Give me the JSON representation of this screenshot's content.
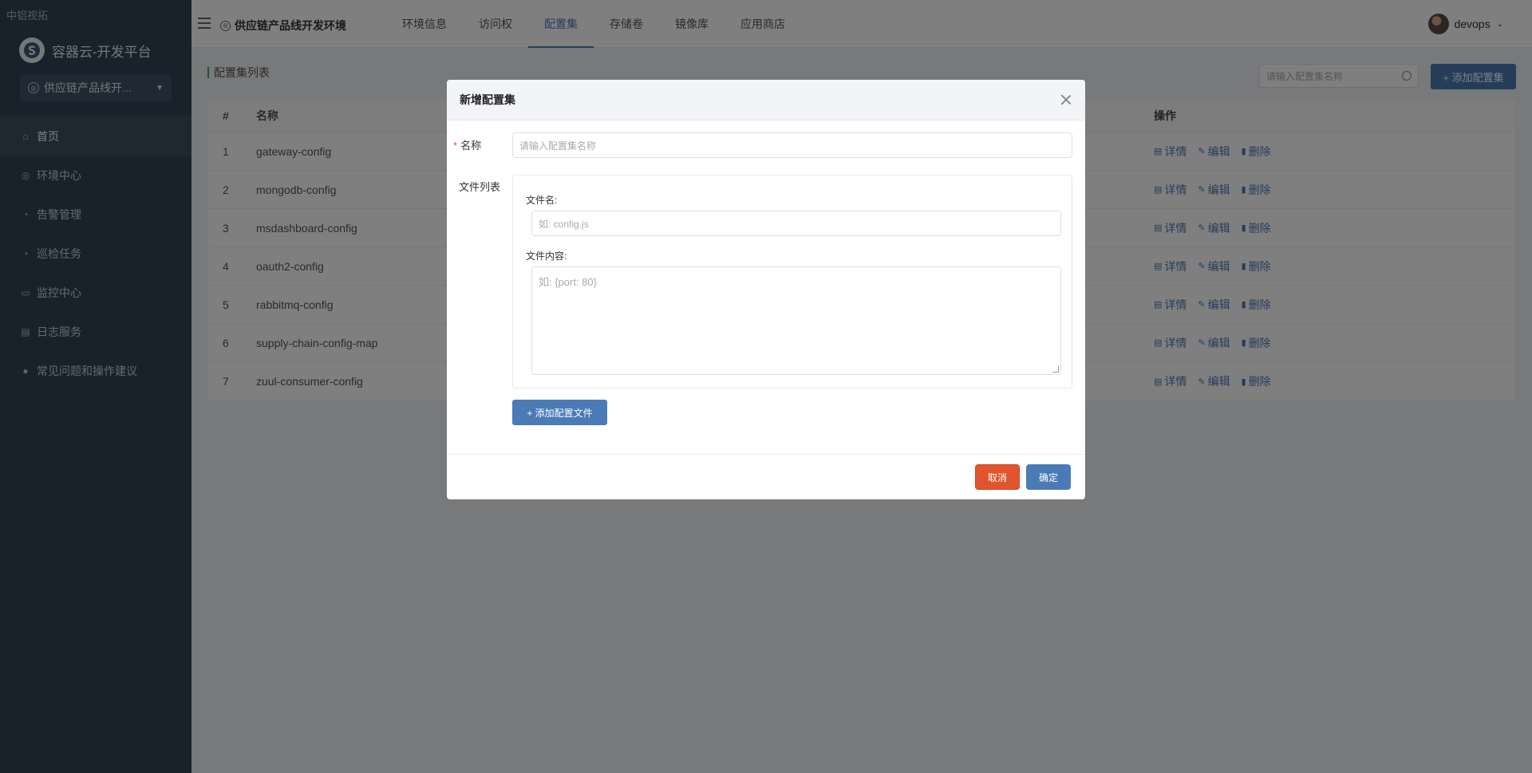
{
  "corner_label": "中铝视拓",
  "brand": {
    "title": "容器云-开发平台"
  },
  "env_select": {
    "value": "供应链产品线开..."
  },
  "nav": [
    {
      "label": "首页",
      "icon": "home-icon"
    },
    {
      "label": "环境中心",
      "icon": "compass-icon"
    },
    {
      "label": "告警管理",
      "icon": "alarm-icon"
    },
    {
      "label": "巡检任务",
      "icon": "inspect-icon"
    },
    {
      "label": "监控中心",
      "icon": "monitor-icon"
    },
    {
      "label": "日志服务",
      "icon": "log-icon"
    },
    {
      "label": "常见问题和操作建议",
      "icon": "help-icon"
    }
  ],
  "header": {
    "env_title": "供应链产品线开发环境",
    "tabs": [
      "环境信息",
      "访问权",
      "配置集",
      "存储卷",
      "镜像库",
      "应用商店"
    ],
    "active_tab": "配置集",
    "user": "devops"
  },
  "list": {
    "title": "配置集列表",
    "search_placeholder": "请输入配置集名称",
    "add_label": "+ 添加配置集",
    "columns": {
      "index": "#",
      "name": "名称",
      "ops": "操作"
    },
    "rows": [
      {
        "index": "1",
        "name": "gateway-config"
      },
      {
        "index": "2",
        "name": "mongodb-config"
      },
      {
        "index": "3",
        "name": "msdashboard-config"
      },
      {
        "index": "4",
        "name": "oauth2-config"
      },
      {
        "index": "5",
        "name": "rabbitmq-config"
      },
      {
        "index": "6",
        "name": "supply-chain-config-map"
      },
      {
        "index": "7",
        "name": "zuul-consumer-config"
      }
    ],
    "ops": {
      "detail": "详情",
      "edit": "编辑",
      "delete": "删除"
    }
  },
  "modal": {
    "title": "新增配置集",
    "name_label": "名称",
    "required_mark": "*",
    "name_placeholder": "请输入配置集名称",
    "file_list_label": "文件列表",
    "file_name_label": "文件名:",
    "file_name_placeholder": "如: config.js",
    "file_content_label": "文件内容:",
    "file_content_placeholder": "如: {port: 80}",
    "add_file_label": "+ 添加配置文件",
    "cancel_label": "取消",
    "ok_label": "确定"
  },
  "colors": {
    "primary": "#4a7bb7",
    "danger": "#e0552e",
    "sidebar": "#304456"
  }
}
